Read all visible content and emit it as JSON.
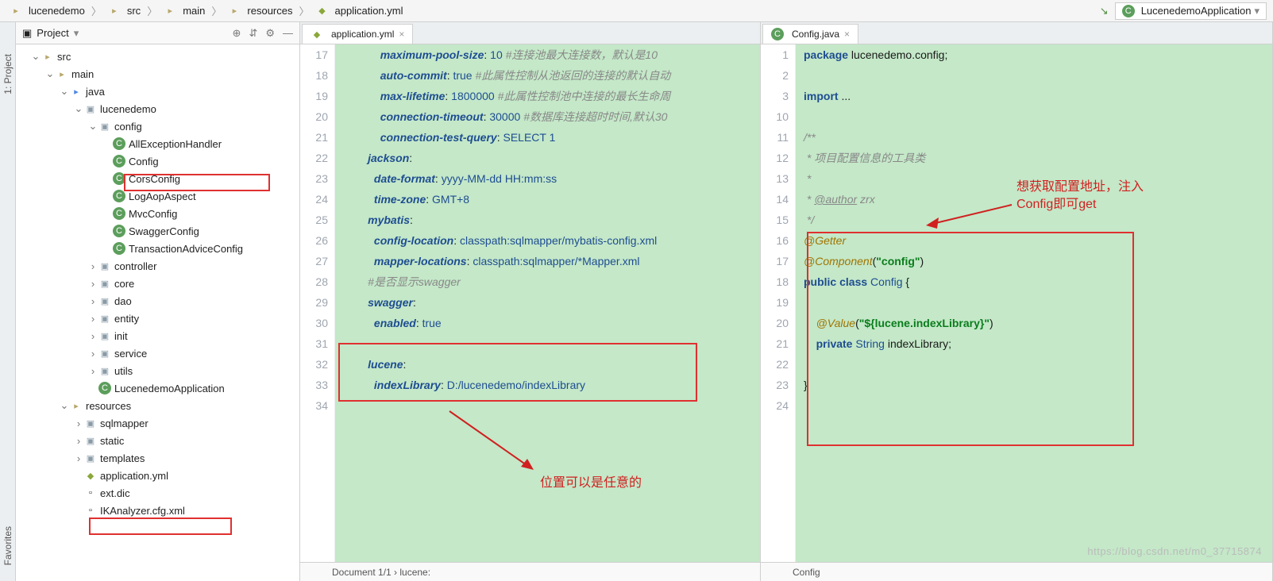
{
  "breadcrumb": [
    "lucenedemo",
    "src",
    "main",
    "resources",
    "application.yml"
  ],
  "runConfig": "LucenedemoApplication",
  "sidebar": {
    "tabs": [
      "1: Project",
      "Favorites"
    ]
  },
  "project": {
    "title": "Project",
    "tree": [
      {
        "d": 1,
        "tw": "v",
        "ic": "folder",
        "l": "src"
      },
      {
        "d": 2,
        "tw": "v",
        "ic": "folder",
        "l": "main"
      },
      {
        "d": 3,
        "tw": "v",
        "ic": "folder",
        "l": "java",
        "blue": true
      },
      {
        "d": 4,
        "tw": "v",
        "ic": "pkg",
        "l": "lucenedemo"
      },
      {
        "d": 5,
        "tw": "v",
        "ic": "pkg",
        "l": "config"
      },
      {
        "d": 6,
        "tw": "",
        "ic": "class",
        "l": "AllExceptionHandler"
      },
      {
        "d": 6,
        "tw": "",
        "ic": "class",
        "l": "Config"
      },
      {
        "d": 6,
        "tw": "",
        "ic": "class",
        "l": "CorsConfig"
      },
      {
        "d": 6,
        "tw": "",
        "ic": "class",
        "l": "LogAopAspect"
      },
      {
        "d": 6,
        "tw": "",
        "ic": "class",
        "l": "MvcConfig"
      },
      {
        "d": 6,
        "tw": "",
        "ic": "class",
        "l": "SwaggerConfig"
      },
      {
        "d": 6,
        "tw": "",
        "ic": "class",
        "l": "TransactionAdviceConfig"
      },
      {
        "d": 5,
        "tw": ">",
        "ic": "pkg",
        "l": "controller"
      },
      {
        "d": 5,
        "tw": ">",
        "ic": "pkg",
        "l": "core"
      },
      {
        "d": 5,
        "tw": ">",
        "ic": "pkg",
        "l": "dao"
      },
      {
        "d": 5,
        "tw": ">",
        "ic": "pkg",
        "l": "entity"
      },
      {
        "d": 5,
        "tw": ">",
        "ic": "pkg",
        "l": "init"
      },
      {
        "d": 5,
        "tw": ">",
        "ic": "pkg",
        "l": "service"
      },
      {
        "d": 5,
        "tw": ">",
        "ic": "pkg",
        "l": "utils"
      },
      {
        "d": 5,
        "tw": "",
        "ic": "class",
        "l": "LucenedemoApplication"
      },
      {
        "d": 3,
        "tw": "v",
        "ic": "folder",
        "l": "resources"
      },
      {
        "d": 4,
        "tw": ">",
        "ic": "pkg",
        "l": "sqlmapper"
      },
      {
        "d": 4,
        "tw": ">",
        "ic": "pkg",
        "l": "static"
      },
      {
        "d": 4,
        "tw": ">",
        "ic": "pkg",
        "l": "templates"
      },
      {
        "d": 4,
        "tw": "",
        "ic": "yml",
        "l": "application.yml"
      },
      {
        "d": 4,
        "tw": "",
        "ic": "file",
        "l": "ext.dic"
      },
      {
        "d": 4,
        "tw": "",
        "ic": "file",
        "l": "IKAnalyzer.cfg.xml"
      }
    ]
  },
  "yml": {
    "tab": "application.yml",
    "lines": [
      {
        "n": 17,
        "i": 6,
        "k": "maximum-pool-size",
        "v": "10",
        "c": "#连接池最大连接数，默认是10"
      },
      {
        "n": 18,
        "i": 6,
        "k": "auto-commit",
        "v": "true",
        "c": "#此属性控制从池返回的连接的默认自动"
      },
      {
        "n": 19,
        "i": 6,
        "k": "max-lifetime",
        "v": "1800000",
        "c": "#此属性控制池中连接的最长生命周"
      },
      {
        "n": 20,
        "i": 6,
        "k": "connection-timeout",
        "v": "30000",
        "c": "#数据库连接超时时间,默认30"
      },
      {
        "n": 21,
        "i": 6,
        "k": "connection-test-query",
        "v": "SELECT 1"
      },
      {
        "n": 22,
        "i": 4,
        "k": "jackson",
        "v": ""
      },
      {
        "n": 23,
        "i": 5,
        "k": "date-format",
        "v": "yyyy-MM-dd HH:mm:ss"
      },
      {
        "n": 24,
        "i": 5,
        "k": "time-zone",
        "v": "GMT+8"
      },
      {
        "n": 25,
        "i": 4,
        "k": "mybatis",
        "v": ""
      },
      {
        "n": 26,
        "i": 5,
        "k": "config-location",
        "v": "classpath:sqlmapper/mybatis-config.xml"
      },
      {
        "n": 27,
        "i": 5,
        "k": "mapper-locations",
        "v": "classpath:sqlmapper/*Mapper.xml"
      },
      {
        "n": 28,
        "i": 4,
        "c": "#是否显示swagger"
      },
      {
        "n": 29,
        "i": 4,
        "k": "swagger",
        "v": ""
      },
      {
        "n": 30,
        "i": 5,
        "k": "enabled",
        "v": "true"
      },
      {
        "n": 31,
        "i": 0
      },
      {
        "n": 32,
        "i": 4,
        "k": "lucene",
        "v": ""
      },
      {
        "n": 33,
        "i": 5,
        "k": "indexLibrary",
        "v": "D:/lucenedemo/indexLibrary"
      },
      {
        "n": 34,
        "i": 0
      }
    ],
    "status": "Document 1/1   ›   lucene:"
  },
  "java": {
    "tab": "Config.java",
    "lines": [
      {
        "n": 1,
        "h": "<span class='jkw'>package</span> lucenedemo.config;"
      },
      {
        "n": 2,
        "h": ""
      },
      {
        "n": 3,
        "h": "<span class='jkw'>import</span> ..."
      },
      {
        "n": 10,
        "h": ""
      },
      {
        "n": 11,
        "h": "<span class='cmt'>/**</span>"
      },
      {
        "n": 12,
        "h": "<span class='cmt'> * 项目配置信息的工具类</span>"
      },
      {
        "n": 13,
        "h": "<span class='cmt'> *</span>"
      },
      {
        "n": 14,
        "h": "<span class='cmt'> * <u>@author</u> zrx</span>"
      },
      {
        "n": 15,
        "h": "<span class='cmt'> */</span>"
      },
      {
        "n": 16,
        "h": "<span class='ann'>@Getter</span>"
      },
      {
        "n": 17,
        "h": "<span class='ann'>@Component</span>(<span class='str'>\"config\"</span>)"
      },
      {
        "n": 18,
        "h": "<span class='jkw'>public class</span> <span class='jtype'>Config</span> {"
      },
      {
        "n": 19,
        "h": ""
      },
      {
        "n": 20,
        "h": "    <span class='ann'>@Value</span>(<span class='str'>\"${lucene.indexLibrary}\"</span>)"
      },
      {
        "n": 21,
        "h": "    <span class='jkw'>private</span> <span class='jtype'>String</span> indexLibrary;"
      },
      {
        "n": 22,
        "h": ""
      },
      {
        "n": 23,
        "h": "}"
      },
      {
        "n": 24,
        "h": ""
      }
    ],
    "status": "Config"
  },
  "anno": {
    "a1": "位置可以是任意的",
    "a2_l1": "想获取配置地址，注入",
    "a2_l2": "Config即可get"
  },
  "watermark": "https://blog.csdn.net/m0_37715874"
}
